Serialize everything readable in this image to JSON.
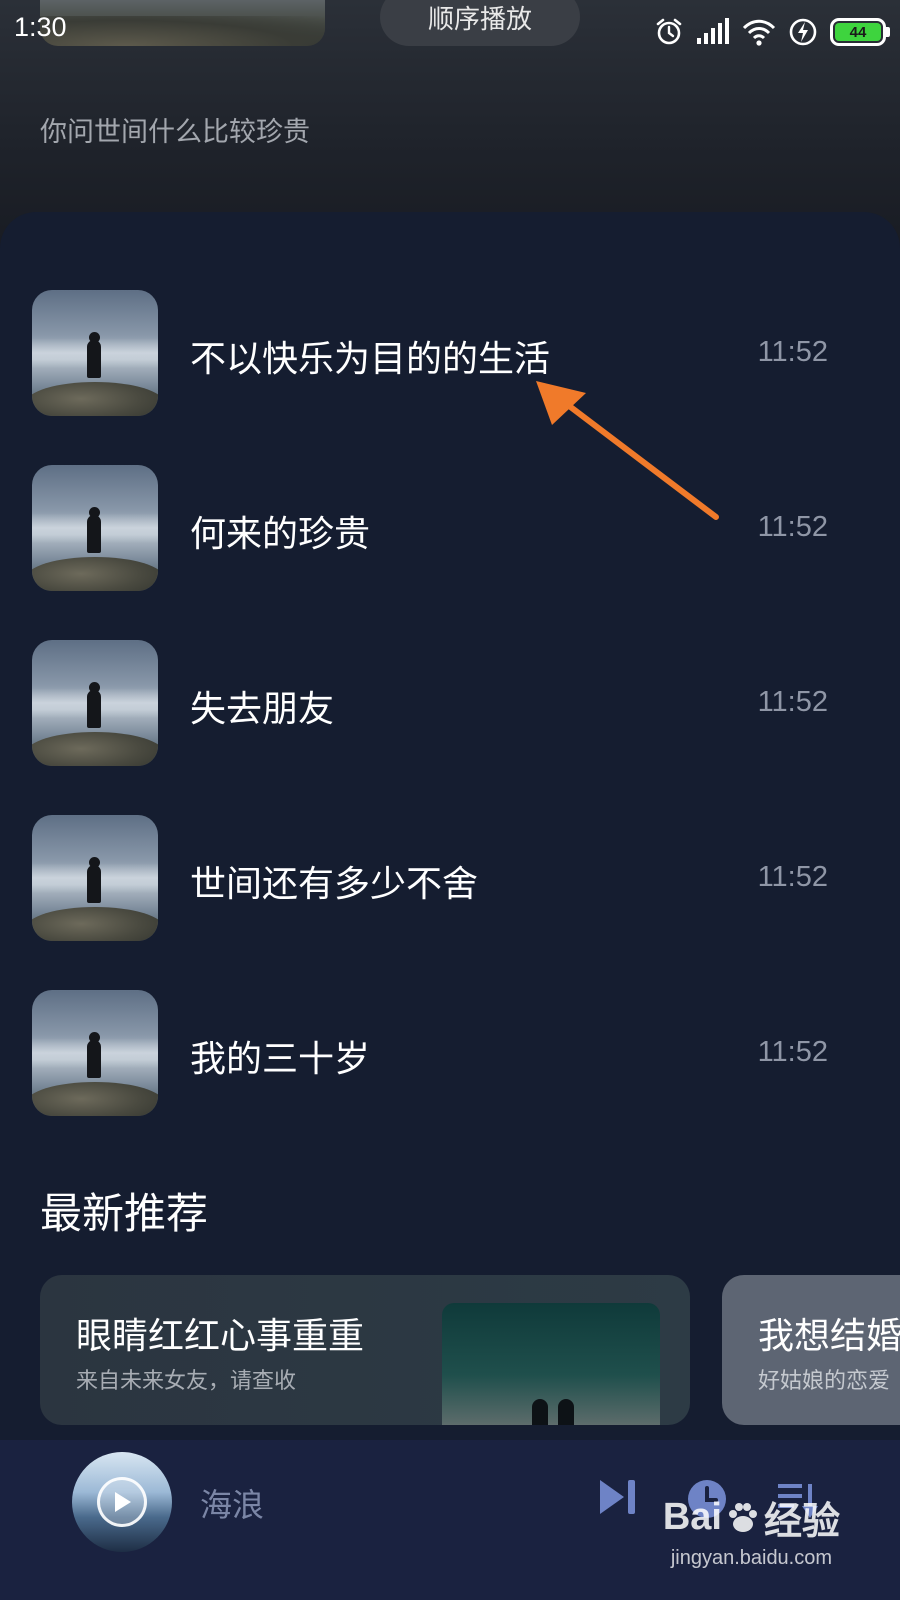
{
  "status_bar": {
    "time": "1:30",
    "battery": "44",
    "icons": [
      "alarm-icon",
      "signal-icon",
      "wifi-icon",
      "charging-icon",
      "battery-icon"
    ]
  },
  "header": {
    "play_mode": "顺序播放",
    "subtitle": "你问世间什么比较珍贵"
  },
  "songs": [
    {
      "title": "不以快乐为目的的生活",
      "time": "11:52"
    },
    {
      "title": "何来的珍贵",
      "time": "11:52"
    },
    {
      "title": "失去朋友",
      "time": "11:52"
    },
    {
      "title": "世间还有多少不舍",
      "time": "11:52"
    },
    {
      "title": "我的三十岁",
      "time": "11:52"
    }
  ],
  "recommend": {
    "title": "最新推荐",
    "cards": [
      {
        "title": "眼睛红红心事重重",
        "subtitle": "来自未来女友，请查收"
      },
      {
        "title": "我想结婚",
        "subtitle": "好姑娘的恋爱"
      }
    ]
  },
  "player": {
    "title": "海浪",
    "icons": [
      "play-icon",
      "next-icon",
      "timer-icon",
      "playlist-icon"
    ]
  },
  "watermark": {
    "brand": "Bai",
    "brand_cn": "经验",
    "url": "jingyan.baidu.com"
  },
  "colors": {
    "background": "#151d30",
    "player_bar": "#1a2240",
    "annotation_arrow": "#f07a2a",
    "battery": "#3ed43e"
  }
}
